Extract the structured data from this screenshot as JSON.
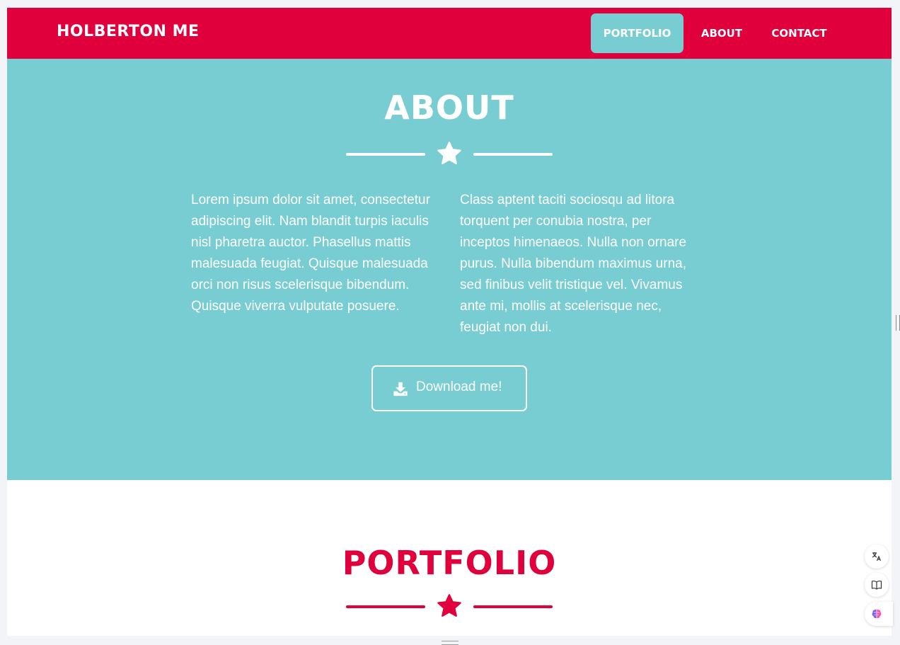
{
  "navbar": {
    "brand": "HOLBERTON ME",
    "items": [
      {
        "label": "PORTFOLIO",
        "active": true
      },
      {
        "label": "ABOUT",
        "active": false
      },
      {
        "label": "CONTACT",
        "active": false
      }
    ]
  },
  "about": {
    "title": "ABOUT",
    "divider_icon": "star-icon",
    "paragraphs": [
      "Lorem ipsum dolor sit amet, consectetur adipiscing elit. Nam blandit turpis iaculis nisl pharetra auctor. Phasellus mattis malesuada feugiat. Quisque malesuada orci non risus scelerisque bibendum. Quisque viverra vulputate posuere.",
      "Class aptent taciti sociosqu ad litora torquent per conubia nostra, per inceptos himenaeos. Nulla non ornare purus. Nulla bibendum maximus urna, sed finibus velit tristique vel. Vivamus ante mi, mollis at scelerisque nec, feugiat non dui."
    ],
    "download_button": {
      "label": "Download me!",
      "icon": "download-icon"
    }
  },
  "portfolio": {
    "title": "PORTFOLIO",
    "divider_icon": "star-icon"
  },
  "floating_tools": [
    {
      "icon": "translate-icon"
    },
    {
      "icon": "book-icon"
    },
    {
      "icon": "brain-icon"
    }
  ],
  "colors": {
    "primary_red": "#e0003c",
    "teal": "#78cdd2",
    "white": "#ffffff"
  }
}
